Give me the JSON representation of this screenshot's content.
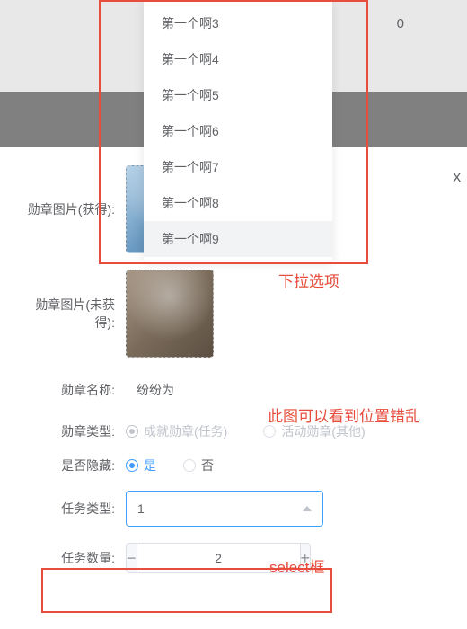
{
  "header": {
    "count": "0"
  },
  "close_label": "X",
  "dropdown": {
    "items": [
      {
        "label": "第一个啊3"
      },
      {
        "label": "第一个啊4"
      },
      {
        "label": "第一个啊5"
      },
      {
        "label": "第一个啊6"
      },
      {
        "label": "第一个啊7"
      },
      {
        "label": "第一个啊8"
      },
      {
        "label": "第一个啊9"
      }
    ]
  },
  "form": {
    "image_obtained": {
      "label": "勋章图片(获得):"
    },
    "image_unobtained": {
      "label": "勋章图片(未获得):"
    },
    "name": {
      "label": "勋章名称:",
      "value": "纷纷为"
    },
    "type": {
      "label": "勋章类型:",
      "options": [
        {
          "label": "成就勋章(任务)"
        },
        {
          "label": "活动勋章(其他)"
        }
      ]
    },
    "hidden": {
      "label": "是否隐藏:",
      "options": [
        {
          "label": "是"
        },
        {
          "label": "否"
        }
      ]
    },
    "task_type": {
      "label": "任务类型:",
      "value": "1"
    },
    "task_count": {
      "label": "任务数量:",
      "value": "2",
      "minus": "−",
      "plus": "+"
    }
  },
  "annotations": {
    "dropdown_label": "下拉选项",
    "misplaced_label": "此图可以看到位置错乱",
    "select_label": "select框"
  }
}
